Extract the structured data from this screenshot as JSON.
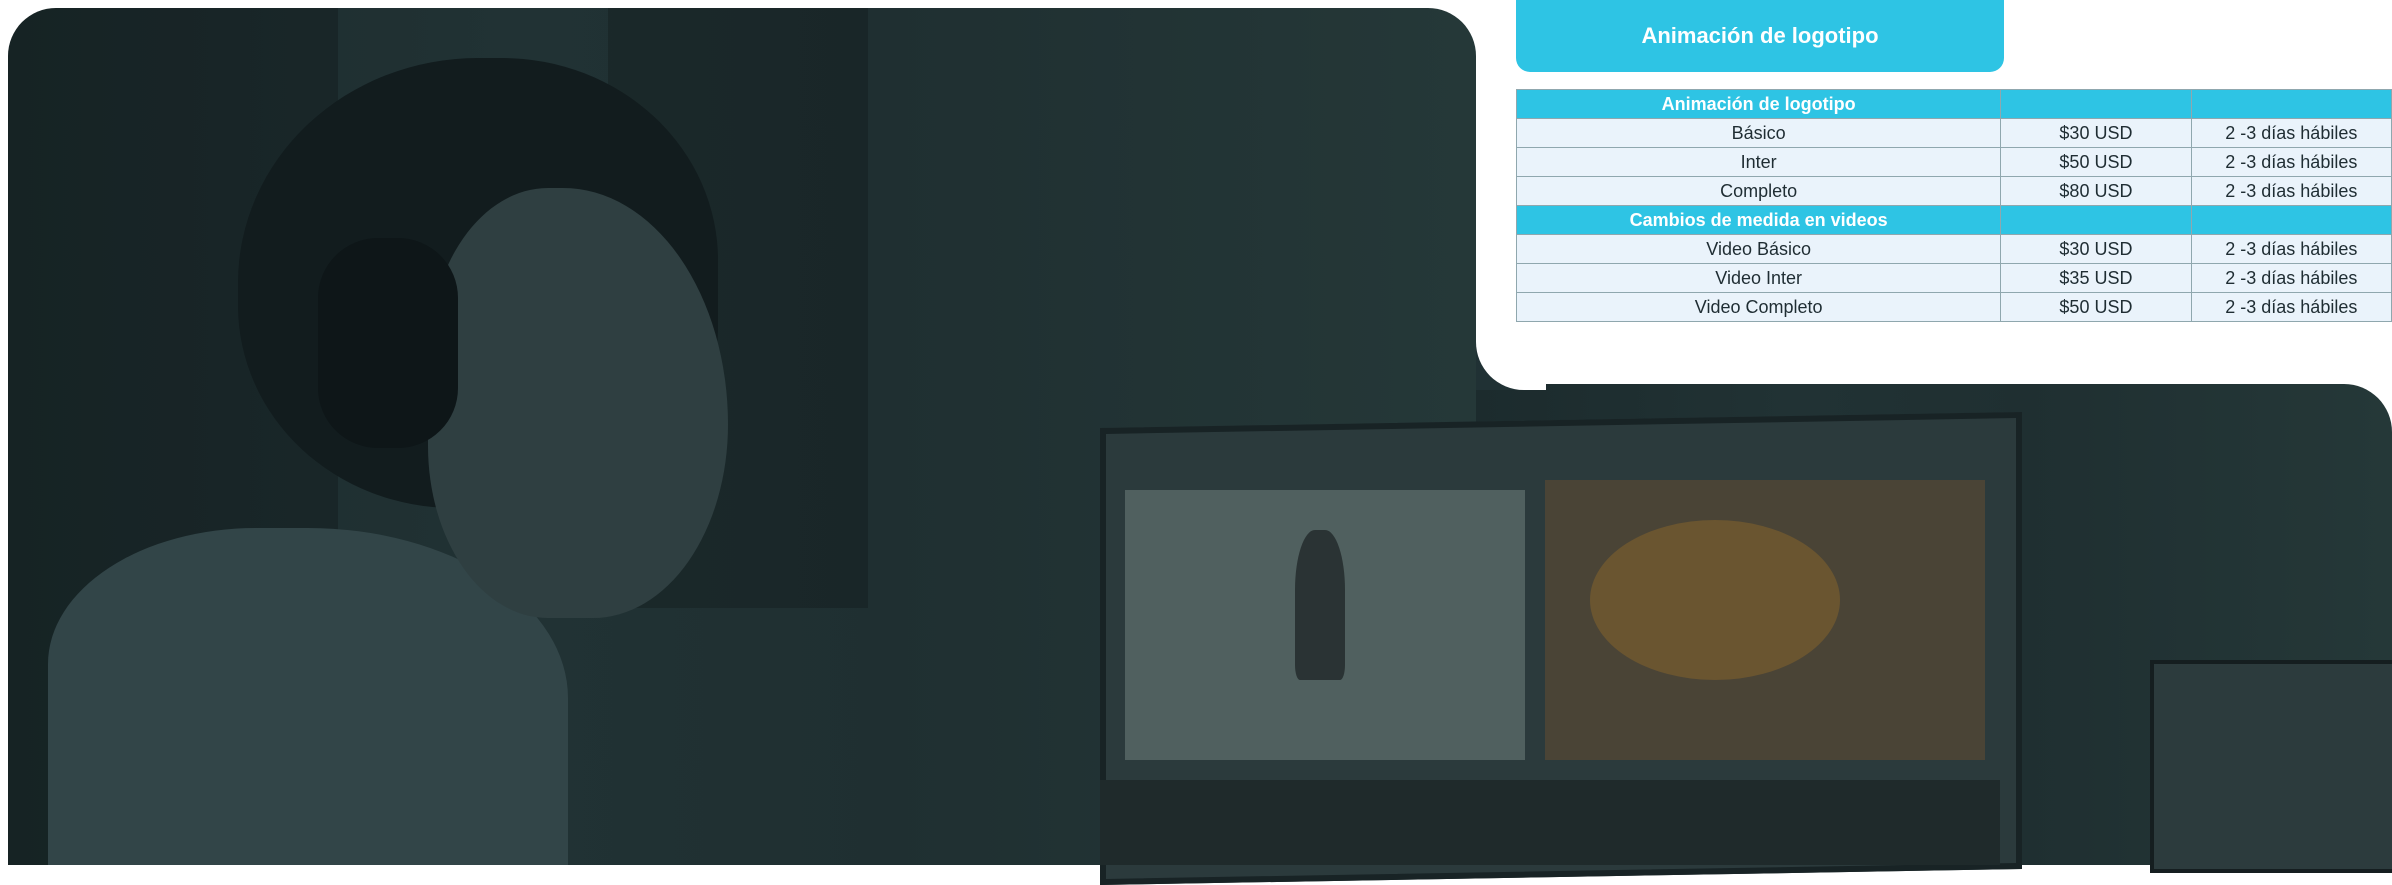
{
  "card": {
    "title": "Animación de logotipo"
  },
  "table": {
    "sections": [
      {
        "heading": "Animación de logotipo",
        "rows": [
          {
            "name": "Básico",
            "price": "$30 USD",
            "time": "2 -3 días hábiles"
          },
          {
            "name": "Inter",
            "price": "$50 USD",
            "time": "2 -3 días hábiles"
          },
          {
            "name": "Completo",
            "price": "$80 USD",
            "time": "2 -3 días hábiles"
          }
        ]
      },
      {
        "heading": "Cambios de medida en videos",
        "rows": [
          {
            "name": "Video Básico",
            "price": "$30 USD",
            "time": "2 -3 días hábiles"
          },
          {
            "name": "Video Inter",
            "price": "$35 USD",
            "time": "2 -3 días hábiles"
          },
          {
            "name": "Video Completo",
            "price": "$50 USD",
            "time": "2 -3 días hábiles"
          }
        ]
      }
    ]
  },
  "colors": {
    "accent": "#2ec4e4",
    "row_bg": "#eaf3fb",
    "photo_tint": "#1f2f31"
  }
}
